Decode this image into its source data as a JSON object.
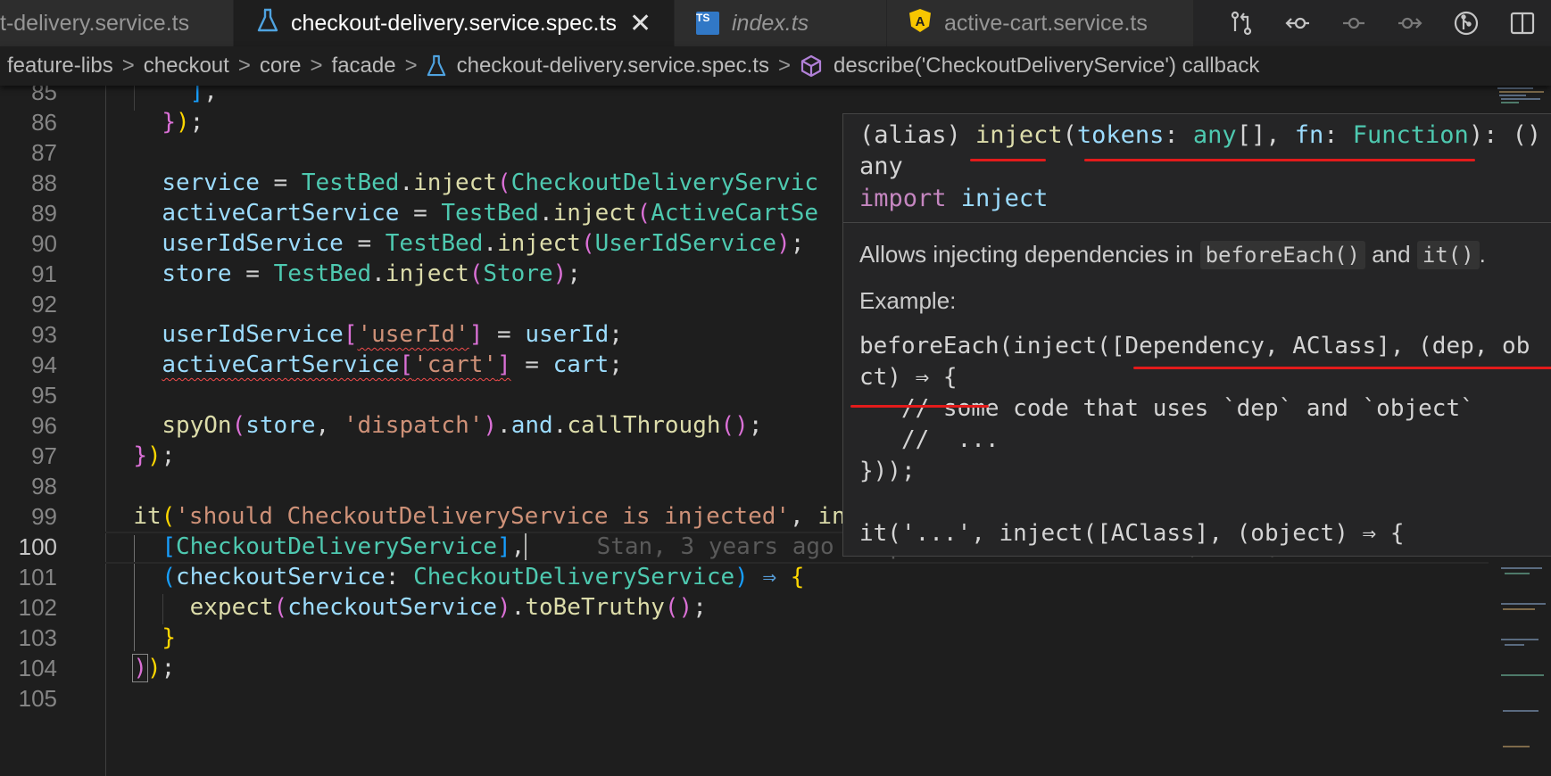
{
  "tabs": [
    {
      "label": "t-delivery.service.ts",
      "active": false,
      "italic": false,
      "icon": "none"
    },
    {
      "label": "checkout-delivery.service.spec.ts",
      "active": true,
      "italic": false,
      "icon": "flask-icon"
    },
    {
      "label": "index.ts",
      "active": false,
      "italic": true,
      "icon": "ts-icon"
    },
    {
      "label": "active-cart.service.ts",
      "active": false,
      "italic": false,
      "icon": "angular-icon"
    }
  ],
  "tab_close_glyph": "✕",
  "ts_badge_text": "TS",
  "angular_badge_text": "A",
  "editor_actions": [
    "source-control-compare-icon",
    "go-back-icon",
    "timeline-icon",
    "go-forward-icon",
    "git-graph-icon",
    "split-editor-icon"
  ],
  "breadcrumb": {
    "items": [
      "feature-libs",
      "checkout",
      "core",
      "facade",
      "checkout-delivery.service.spec.ts",
      "describe('CheckoutDeliveryService') callback"
    ],
    "separator": ">"
  },
  "line_numbers": [
    "85",
    "86",
    "87",
    "88",
    "89",
    "90",
    "91",
    "92",
    "93",
    "94",
    "95",
    "96",
    "97",
    "98",
    "99",
    "100",
    "101",
    "102",
    "103",
    "104",
    "105"
  ],
  "current_line": "100",
  "blame": "Stan, 3 years ago • Split checkout facade (#2890)",
  "hover": {
    "signature_line1": [
      "(alias) ",
      "inject",
      "(",
      "tokens",
      ": ",
      "any",
      "[], ",
      "fn",
      ": ",
      "Function",
      "): ()"
    ],
    "signature_line2": "any",
    "signature_line3": [
      "import",
      " inject"
    ],
    "doc_text_before": "Allows injecting dependencies in",
    "doc_code1": "beforeEach()",
    "doc_and": "and",
    "doc_code2": "it()",
    "doc_period": ".",
    "example_label": "Example:",
    "example_lines": [
      "beforeEach(inject([Dependency, AClass], (dep, ob",
      "ct) ⇒ {",
      "   // some code that uses `dep` and `object`",
      "   //  ...",
      "}));",
      "",
      "it('...', inject([AClass], (object) ⇒ {"
    ]
  },
  "colors": {
    "background": "#1e1e1e",
    "tab_active": "#1e1e1e",
    "tab_inactive": "#2d2d2d",
    "annotation_red": "#e31b1b",
    "ts_blue": "#3178c6",
    "angular_yellow": "#f7c600",
    "flask_blue": "#4fa3e0"
  }
}
